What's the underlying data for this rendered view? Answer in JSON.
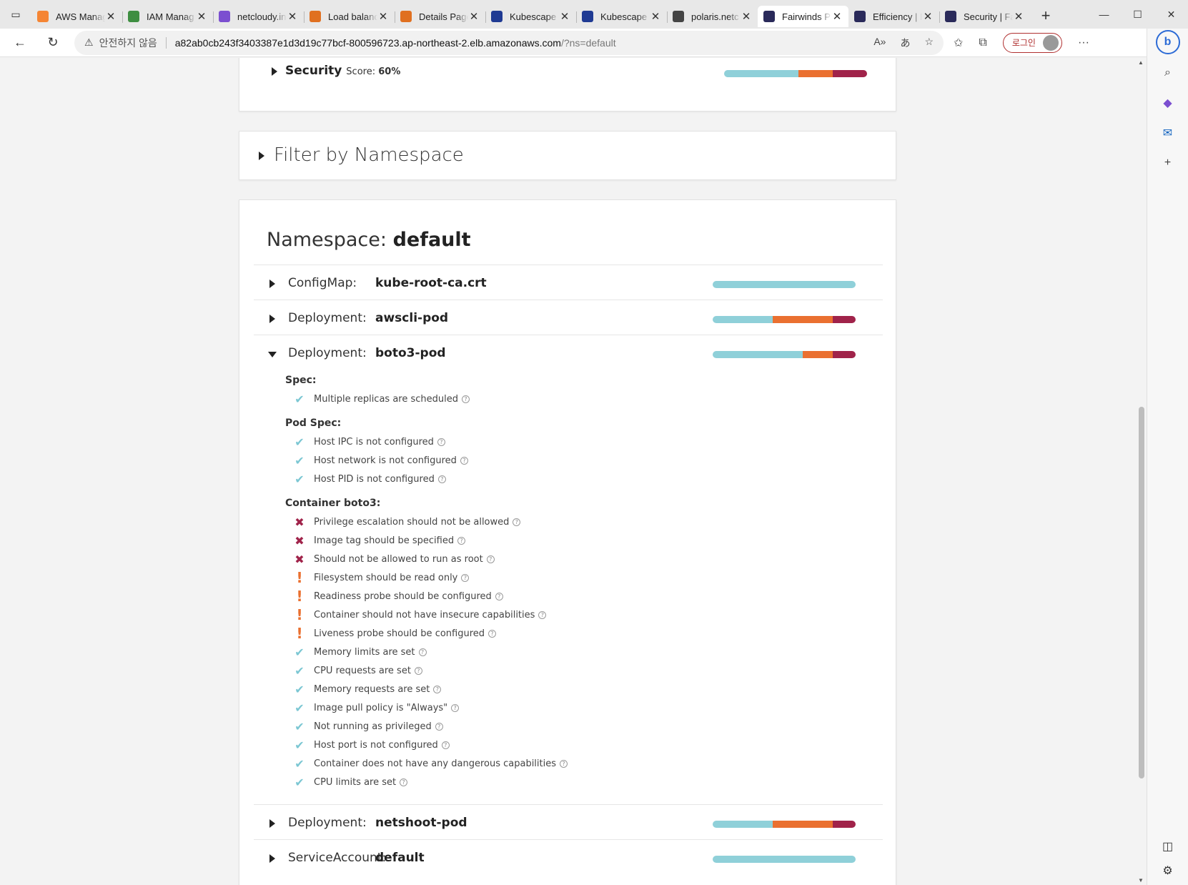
{
  "browser": {
    "tabs": [
      {
        "title": "AWS Manag",
        "favicon_color": "#f58534",
        "active": false
      },
      {
        "title": "IAM Manag",
        "favicon_color": "#3e8e41",
        "active": false
      },
      {
        "title": "netcloudy.in",
        "favicon_color": "#7b4fd0",
        "active": false
      },
      {
        "title": "Load balanc",
        "favicon_color": "#e07020",
        "active": false
      },
      {
        "title": "Details Page",
        "favicon_color": "#e07020",
        "active": false
      },
      {
        "title": "Kubescape",
        "favicon_color": "#1f3a93",
        "active": false
      },
      {
        "title": "Kubescape",
        "favicon_color": "#1f3a93",
        "active": false
      },
      {
        "title": "polaris.netc",
        "favicon_color": "#444444",
        "active": false
      },
      {
        "title": "Fairwinds P",
        "favicon_color": "#2a2a5a",
        "active": true
      },
      {
        "title": "Efficiency | F",
        "favicon_color": "#2a2a5a",
        "active": false
      },
      {
        "title": "Security | Fa",
        "favicon_color": "#2a2a5a",
        "active": false
      }
    ],
    "address": {
      "insecure_label": "안전하지 않음",
      "url_host": "a82ab0cb243f3403387e1d3d19c77bcf-800596723.ap-northeast-2.elb.amazonaws.com",
      "url_path": "/?ns=default"
    },
    "login_label": "로그인"
  },
  "security_section": {
    "title": "Security",
    "score_label": "Score:",
    "score_value": "60%",
    "bar": {
      "pass": 0.52,
      "warning": 0.24,
      "danger": 0.24
    }
  },
  "filter_section": {
    "title": "Filter by Namespace"
  },
  "namespace": {
    "label": "Namespace:",
    "name": "default",
    "resources": [
      {
        "kind": "ConfigMap:",
        "name": "kube-root-ca.crt",
        "expanded": false,
        "bar": {
          "pass": 1.0,
          "warning": 0.0,
          "danger": 0.0
        }
      },
      {
        "kind": "Deployment:",
        "name": "awscli-pod",
        "expanded": false,
        "bar": {
          "pass": 0.42,
          "warning": 0.42,
          "danger": 0.16
        }
      },
      {
        "kind": "Deployment:",
        "name": "boto3-pod",
        "expanded": true,
        "bar": {
          "pass": 0.63,
          "warning": 0.21,
          "danger": 0.16
        }
      },
      {
        "kind": "Deployment:",
        "name": "netshoot-pod",
        "expanded": false,
        "bar": {
          "pass": 0.42,
          "warning": 0.42,
          "danger": 0.16
        }
      },
      {
        "kind": "ServiceAccount:",
        "name": "default",
        "expanded": false,
        "bar": {
          "pass": 1.0,
          "warning": 0.0,
          "danger": 0.0
        }
      }
    ]
  },
  "boto3_checks": [
    {
      "group": "Spec:",
      "items": [
        {
          "status": "pass",
          "message": "Multiple replicas are scheduled"
        }
      ]
    },
    {
      "group": "Pod Spec:",
      "items": [
        {
          "status": "pass",
          "message": "Host IPC is not configured"
        },
        {
          "status": "pass",
          "message": "Host network is not configured"
        },
        {
          "status": "pass",
          "message": "Host PID is not configured"
        }
      ]
    },
    {
      "group": "Container boto3:",
      "items": [
        {
          "status": "danger",
          "message": "Privilege escalation should not be allowed"
        },
        {
          "status": "danger",
          "message": "Image tag should be specified"
        },
        {
          "status": "danger",
          "message": "Should not be allowed to run as root"
        },
        {
          "status": "warning",
          "message": "Filesystem should be read only"
        },
        {
          "status": "warning",
          "message": "Readiness probe should be configured"
        },
        {
          "status": "warning",
          "message": "Container should not have insecure capabilities"
        },
        {
          "status": "warning",
          "message": "Liveness probe should be configured"
        },
        {
          "status": "pass",
          "message": "Memory limits are set"
        },
        {
          "status": "pass",
          "message": "CPU requests are set"
        },
        {
          "status": "pass",
          "message": "Memory requests are set"
        },
        {
          "status": "pass",
          "message": "Image pull policy is \"Always\""
        },
        {
          "status": "pass",
          "message": "Not running as privileged"
        },
        {
          "status": "pass",
          "message": "Host port is not configured"
        },
        {
          "status": "pass",
          "message": "Container does not have any dangerous capabilities"
        },
        {
          "status": "pass",
          "message": "CPU limits are set"
        }
      ]
    }
  ],
  "colors": {
    "pass": "#8fd0d9",
    "warning": "#ea7030",
    "danger": "#a0234a"
  },
  "icons": {
    "pass": "check-icon",
    "warning": "exclamation-icon",
    "danger": "cross-icon",
    "help": "question-circle-icon"
  }
}
